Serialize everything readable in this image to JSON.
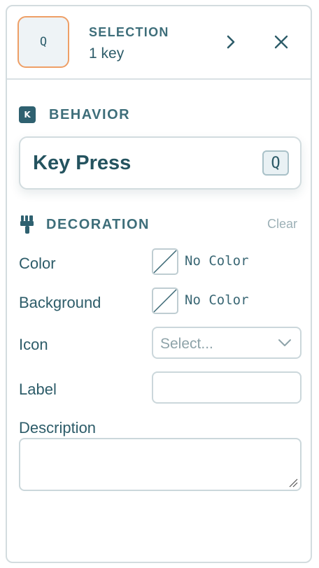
{
  "header": {
    "key_glyph": "Q",
    "title": "SELECTION",
    "subtitle": "1 key",
    "next_icon": "chevron-right-icon",
    "close_icon": "close-icon"
  },
  "behavior": {
    "badge": "K",
    "title": "BEHAVIOR",
    "name": "Key Press",
    "key": "Q"
  },
  "decoration": {
    "icon": "paintbrush-icon",
    "title": "DECORATION",
    "clear_label": "Clear",
    "color": {
      "label": "Color",
      "value": "No Color"
    },
    "background": {
      "label": "Background",
      "value": "No Color"
    },
    "icon_field": {
      "label": "Icon",
      "placeholder": "Select..."
    },
    "label_field": {
      "label": "Label",
      "value": ""
    },
    "description_field": {
      "label": "Description",
      "value": ""
    }
  },
  "colors": {
    "accent": "#ee9f66",
    "text": "#285a68",
    "border": "#d3dcdf"
  }
}
